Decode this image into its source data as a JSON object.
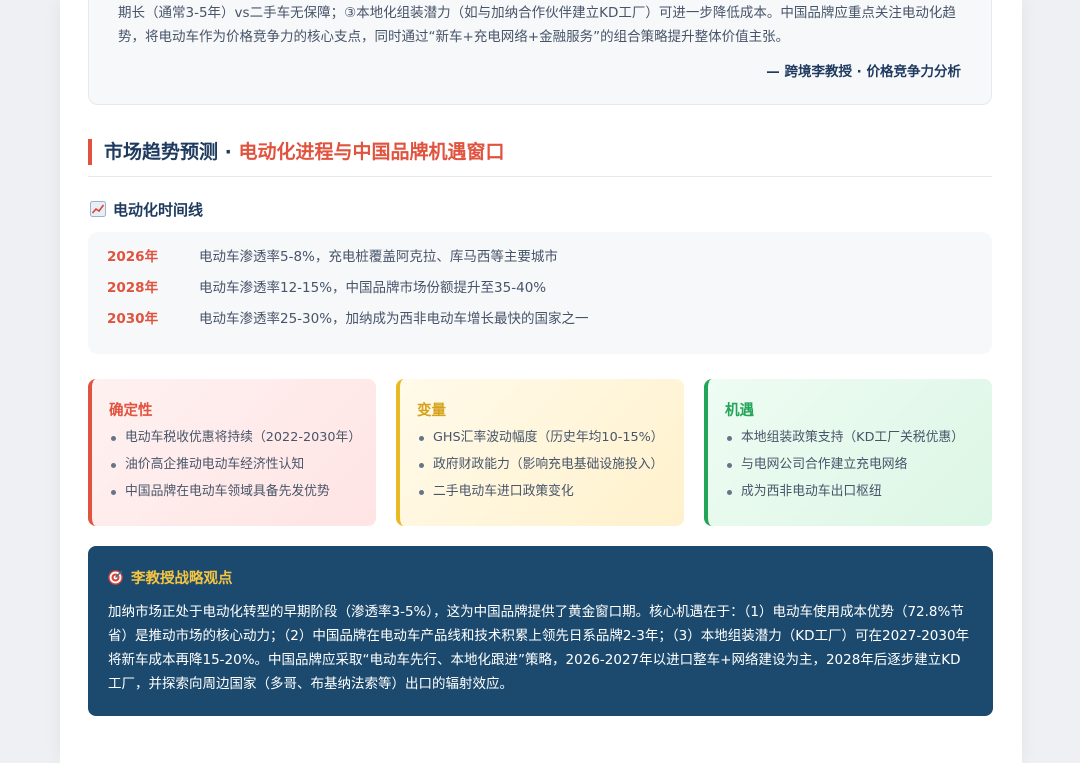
{
  "quote": {
    "text": "期长（通常3-5年）vs二手车无保障；③本地化组装潜力（如与加纳合作伙伴建立KD工厂）可进一步降低成本。中国品牌应重点关注电动化趋势，将电动车作为价格竞争力的核心支点，同时通过“新车+充电网络+金融服务”的组合策略提升整体价值主张。",
    "author": "— 跨境李教授 · 价格竞争力分析"
  },
  "section": {
    "title_main": "市场趋势预测 · ",
    "title_highlight": "电动化进程与中国品牌机遇窗口"
  },
  "timeline": {
    "heading": "电动化时间线",
    "icon": "chart-increasing-icon",
    "items": [
      {
        "year": "2026年",
        "text": "电动车渗透率5-8%，充电桩覆盖阿克拉、库马西等主要城市"
      },
      {
        "year": "2028年",
        "text": "电动车渗透率12-15%，中国品牌市场份额提升至35-40%"
      },
      {
        "year": "2030年",
        "text": "电动车渗透率25-30%，加纳成为西非电动车增长最快的国家之一"
      }
    ]
  },
  "cards": [
    {
      "title": "确定性",
      "accent": "#e0533f",
      "items": [
        "电动车税收优惠将持续（2022-2030年）",
        "油价高企推动电动车经济性认知",
        "中国品牌在电动车领域具备先发优势"
      ]
    },
    {
      "title": "变量",
      "accent": "#e8b923",
      "items": [
        "GHS汇率波动幅度（历史年均10-15%）",
        "政府财政能力（影响充电基础设施投入）",
        "二手电动车进口政策变化"
      ]
    },
    {
      "title": "机遇",
      "accent": "#22a559",
      "items": [
        "本地组装政策支持（KD工厂关税优惠）",
        "与电网公司合作建立充电网络",
        "成为西非电动车出口枢纽"
      ]
    }
  ],
  "strategy": {
    "icon": "target-icon",
    "title": "李教授战略观点",
    "text": "加纳市场正处于电动化转型的早期阶段（渗透率3-5%），这为中国品牌提供了黄金窗口期。核心机遇在于：（1）电动车使用成本优势（72.8%节省）是推动市场的核心动力；（2）中国品牌在电动车产品线和技术积累上领先日系品牌2-3年；（3）本地组装潜力（KD工厂）可在2027-2030年将新车成本再降15-20%。中国品牌应采取“电动车先行、本地化跟进”策略，2026-2027年以进口整车+网络建设为主，2028年后逐步建立KD工厂，并探索向周边国家（多哥、布基纳法索等）出口的辐射效应。"
  }
}
